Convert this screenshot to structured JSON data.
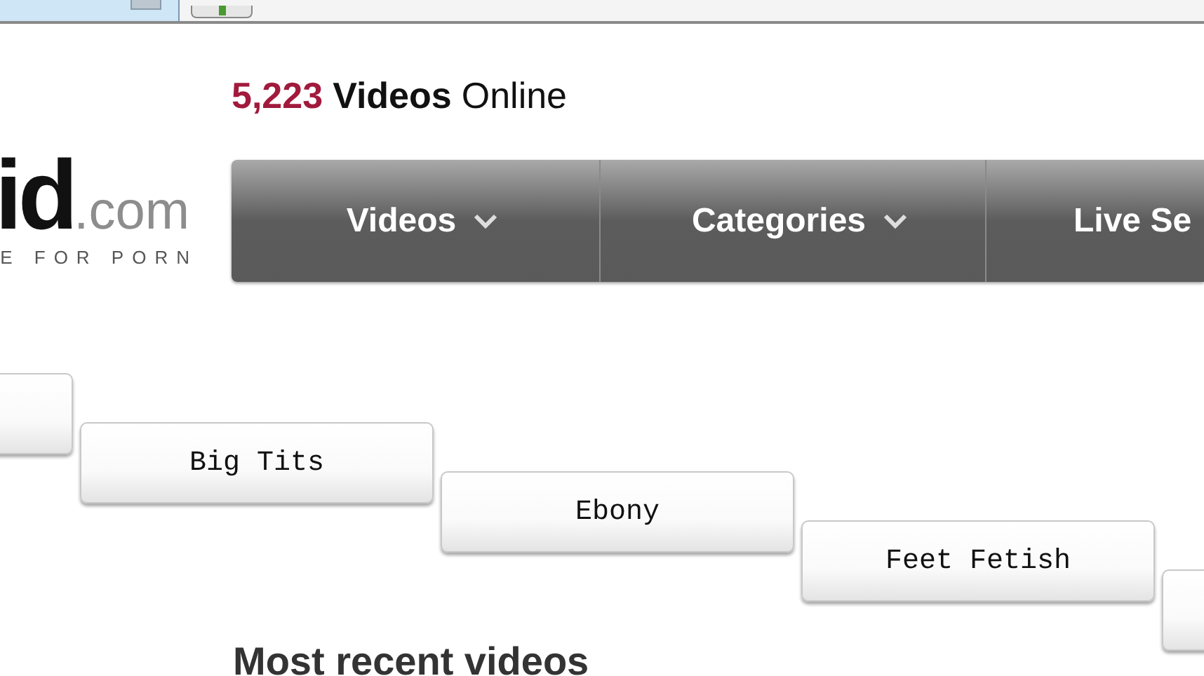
{
  "logo": {
    "name": "id",
    "domain": ".com",
    "tagline": "E FOR PORN"
  },
  "counter": {
    "count": "5,223",
    "noun": "Videos",
    "suffix": "Online"
  },
  "nav": [
    {
      "label": "Videos",
      "has_caret": true
    },
    {
      "label": "Categories",
      "has_caret": true
    },
    {
      "label": "Live Se"
    }
  ],
  "categories": [
    {
      "label": "Big Tits"
    },
    {
      "label": "Ebony"
    },
    {
      "label": "Feet Fetish"
    }
  ],
  "section_title": "Most recent videos"
}
